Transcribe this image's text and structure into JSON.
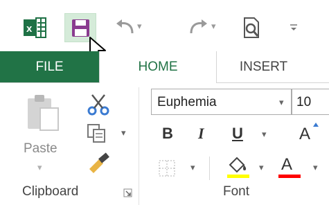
{
  "qat": {
    "app_icon": "excel-icon",
    "save_icon": "save-icon",
    "undo_icon": "undo-icon",
    "redo_icon": "redo-icon",
    "print_preview_icon": "print-preview-icon",
    "customize_icon": "customize-qat-icon"
  },
  "tabs": {
    "file": "FILE",
    "home": "HOME",
    "insert": "INSERT"
  },
  "clipboard": {
    "paste_label": "Paste",
    "group_label": "Clipboard"
  },
  "font": {
    "font_name": "Euphemia",
    "font_size": "10",
    "bold": "B",
    "italic": "I",
    "underline": "U",
    "grow": "A",
    "font_color": "A",
    "group_label": "Font"
  },
  "colors": {
    "excel_green": "#217346",
    "highlight_yellow": "#ffff00",
    "font_red": "#ff0000",
    "save_purple": "#8a3b8f"
  }
}
